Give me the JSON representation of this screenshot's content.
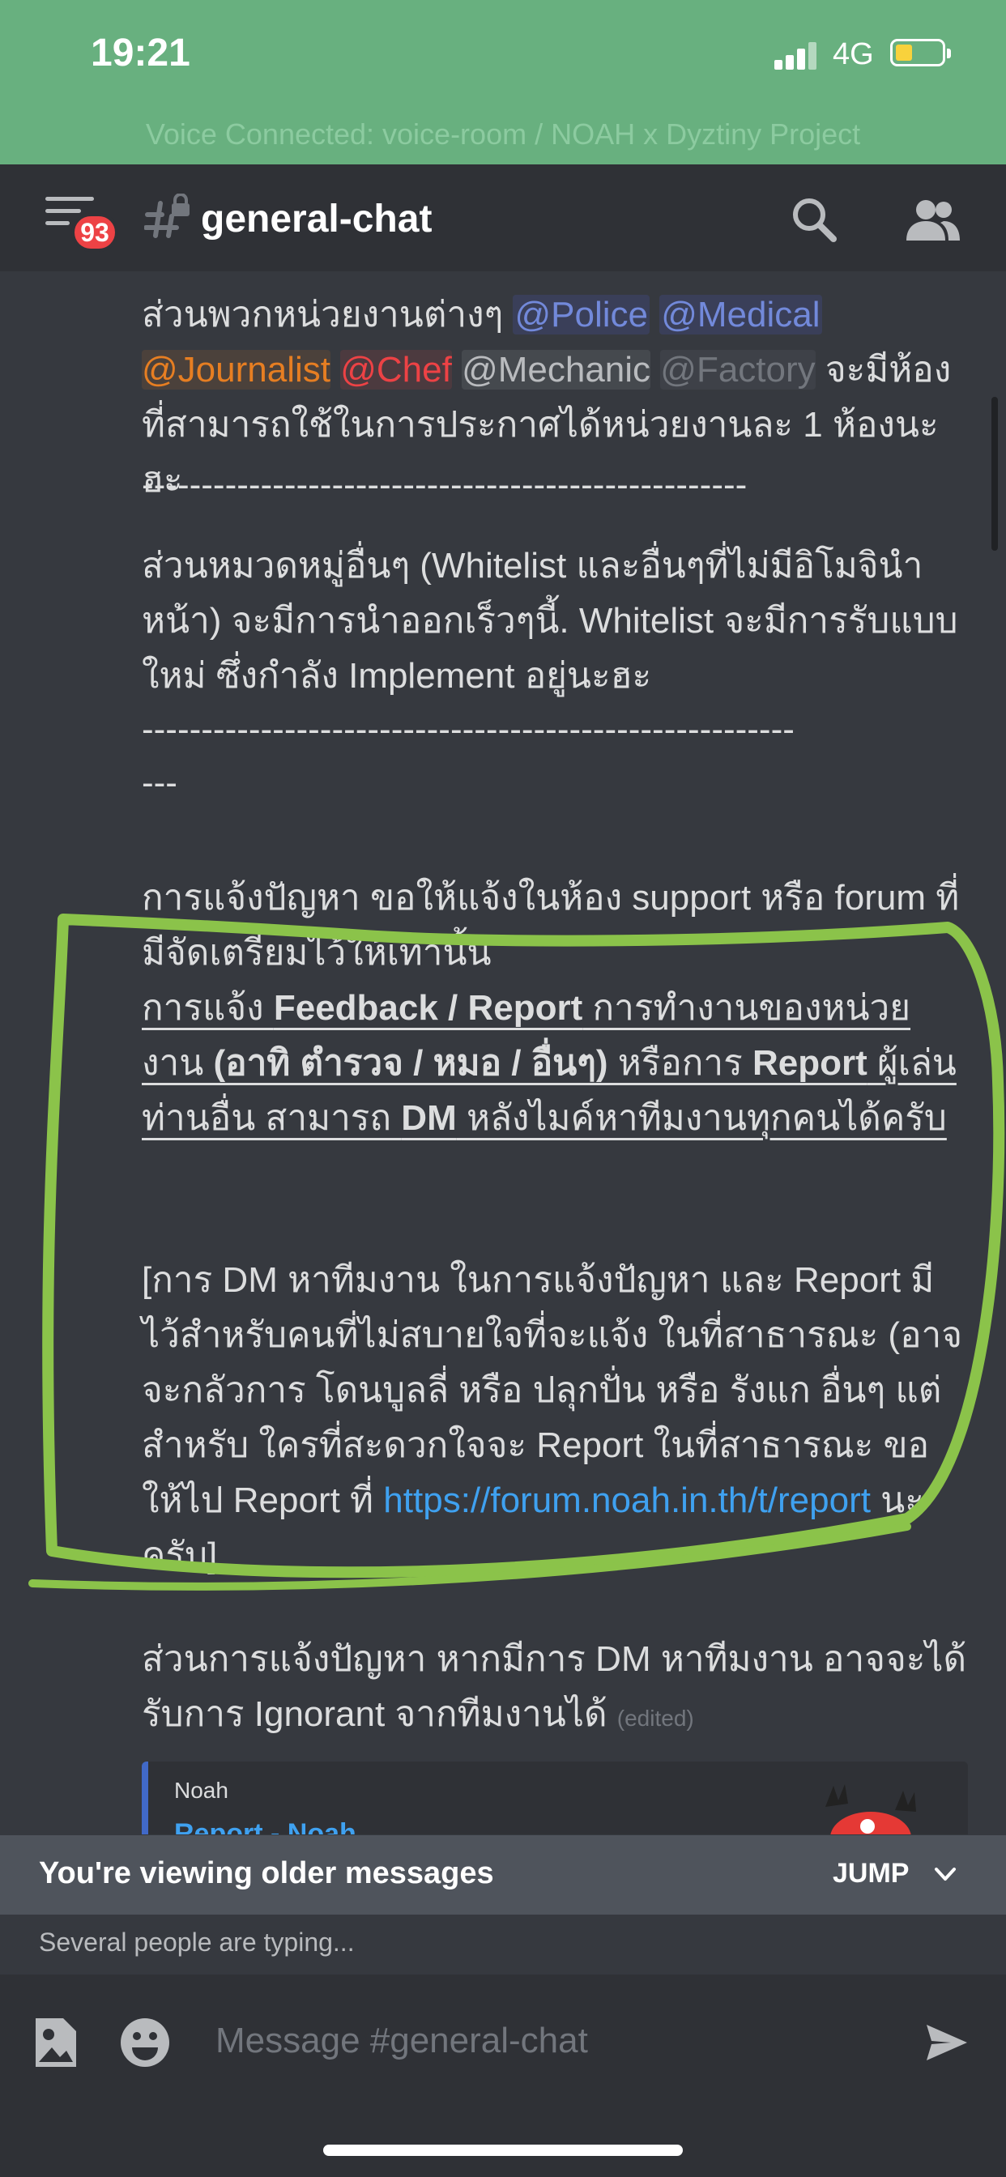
{
  "status_bar": {
    "time": "19:21",
    "network": "4G"
  },
  "voice_banner": "Voice Connected: voice-room / NOAH x Dyztiny Project",
  "header": {
    "badge_count": "93",
    "channel_name": "general-chat"
  },
  "messages": {
    "m1": {
      "text1": "ส่วนพวกหน่วยงานต่างๆ ",
      "mention_police": "@Police",
      "mention_medical": "@Medical",
      "mention_journalist": "@Journalist",
      "mention_chef": "@Chef",
      "mention_mechanic": "@Mechanic",
      "mention_factory": "@Factory",
      "text2": " จะมีห้องที่สามารถใช้ในการประกาศได้หน่วยงานละ 1 ห้องนะฮะ"
    },
    "divider1": "---------------------------------------------------",
    "m2": "ส่วนหมวดหมู่อื่นๆ (Whitelist และอื่นๆที่ไม่มีอิโมจินำหน้า) จะมีการนำออกเร็วๆนี้. Whitelist จะมีการรับแบบใหม่ ซึ่งกำลัง Implement อยู่นะฮะ",
    "divider2": "-------------------------------------------------------",
    "divider2_tail": "---",
    "m3": "การแจ้งปัญหา ขอให้แจ้งในห้อง support หรือ forum ที่มีจัดเตรียมไว้ให้เท่านั้น",
    "m4": {
      "p1": "การแจ้ง ",
      "b1": "Feedback / Report",
      "p2": " การทำงานของหน่วยงาน ",
      "b2": "(อาทิ ตำรวจ / หมอ / อื่นๆ)",
      "p3": " หรือการ ",
      "b3": "Report",
      "p4": " ผู้เล่นท่านอื่น สามารถ ",
      "b4": "DM",
      "p5": " หลังไมค์หาทีมงานทุกคนได้ครับ"
    },
    "m5": {
      "text": "[การ DM หาทีมงาน ในการแจ้งปัญหา และ Report มีไว้สำหรับคนที่ไม่สบายใจที่จะแจ้ง ในที่สาธารณะ (อาจจะกลัวการ โดนบูลลี่ หรือ ปลุกปั่น หรือ รังแก อื่นๆ แต่สำหรับ ใครที่สะดวกใจจะ Report  ในที่สาธารณะ ขอให้ไป Report ที่ ",
      "link": "https://forum.noah.in.th/t/report",
      "tail": " นะครับ]"
    },
    "m6": {
      "text": "ส่วนการแจ้งปัญหา หากมีการ DM หาทีมงาน อาจจะได้รับการ Ignorant จากทีมงานได้ ",
      "edited": "(edited)"
    },
    "embed": {
      "author": "Noah",
      "title": "Report - Noah"
    }
  },
  "older_bar": {
    "text": "You're viewing older messages",
    "jump": "JUMP"
  },
  "typing": "Several people are typing...",
  "composer": {
    "placeholder": "Message #general-chat"
  },
  "colors": {
    "accent": "#5865f2",
    "annotation": "#8bc34a",
    "status_bg": "#68b07f",
    "link": "#3fa1f0"
  },
  "icons": [
    "menu-icon",
    "channel-hash-lock-icon",
    "search-icon",
    "members-icon",
    "chevron-down-icon",
    "gallery-icon",
    "emoji-icon",
    "send-icon"
  ]
}
